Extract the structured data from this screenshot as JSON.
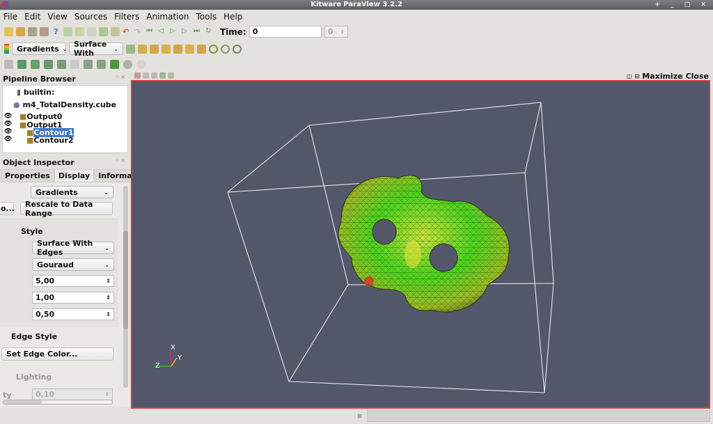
{
  "window": {
    "title": "Kitware ParaView 3.2.2"
  },
  "menu": [
    "File",
    "Edit",
    "View",
    "Sources",
    "Filters",
    "Animation",
    "Tools",
    "Help"
  ],
  "toolbar": {
    "time_label": "Time:",
    "time_value": "0",
    "timestep_value": "0",
    "color_by": "Gradients",
    "representation": "Surface With"
  },
  "view": {
    "maximize": "Maximize",
    "close": "Close",
    "background": "#525869",
    "border": "#d23a3a"
  },
  "pipeline": {
    "title": "Pipeline Browser",
    "items": [
      "builtin:",
      "m4_TotalDensity.cube",
      "Output0",
      "Output1",
      "Contour1",
      "Contour2"
    ],
    "selected": "Contour1"
  },
  "inspector": {
    "title": "Object Inspector",
    "tabs": [
      "Properties",
      "Display",
      "Information"
    ],
    "active_tab": "Display",
    "color_by": "Gradients",
    "edit_button": "o...",
    "rescale_button": "Rescale to Data Range",
    "style_header": "Style",
    "representation": "Surface With Edges",
    "interpolation": "Gouraud",
    "point_size": "5,00",
    "line_width": "1,00",
    "opacity": "0,50",
    "edge_style_header": "Edge Style",
    "edge_color_button": "Set Edge Color...",
    "lighting_header": "Lighting",
    "specular_label": "ty",
    "specular_value": "0,10"
  },
  "axes": {
    "x": "X",
    "y": "Y",
    "z": "Z"
  }
}
